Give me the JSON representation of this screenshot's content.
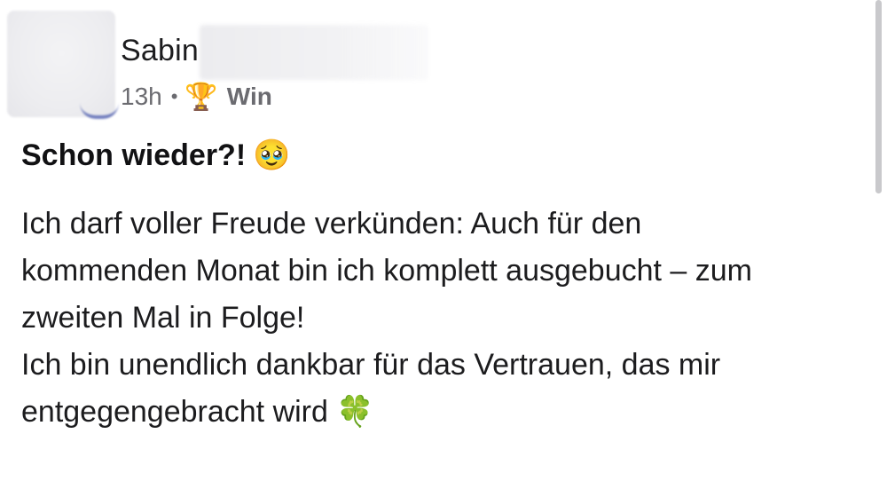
{
  "post": {
    "author_name": "Sabin",
    "timestamp": "13h",
    "separator": "•",
    "badge_icon": "🏆",
    "badge_label": "Win",
    "headline": "Schon wieder?!",
    "headline_emoji": "🥹",
    "body_lines": [
      "Ich darf voller Freude verkünden: Auch für den",
      "kommenden Monat bin ich komplett ausgebucht – zum",
      "zweiten Mal in Folge!",
      "Ich bin unendlich dankbar für das Vertrauen, das mir",
      "entgegengebracht wird"
    ],
    "body_end_emoji": "🍀"
  },
  "icons": {
    "badge": "trophy-icon",
    "headline_emoji": "pleading-face-emoji",
    "end_emoji": "four-leaf-clover-emoji"
  },
  "colors": {
    "text": "#1c1c1e",
    "meta_text": "#6b6b70",
    "avatar_accent": "#3c4ea8"
  }
}
